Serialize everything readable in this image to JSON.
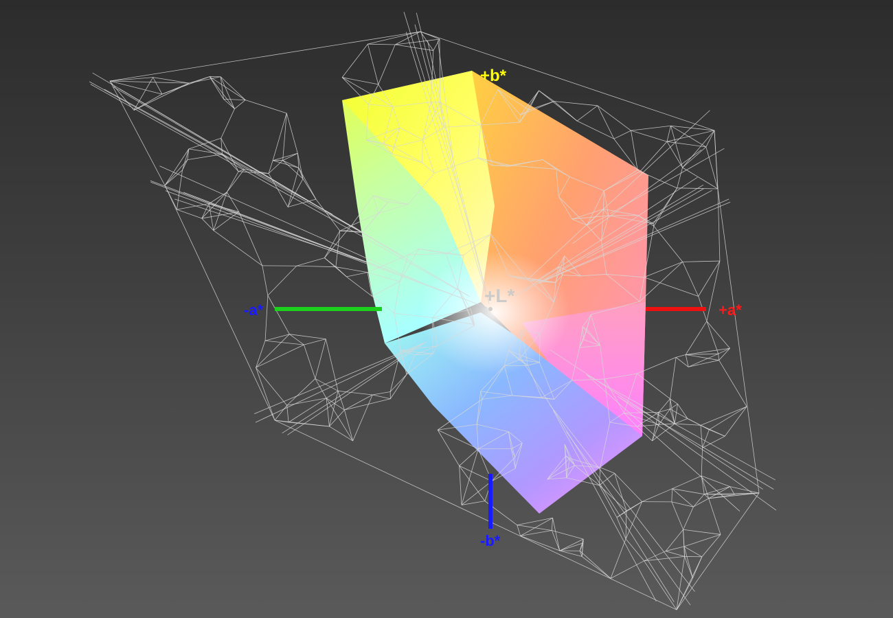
{
  "view": {
    "type": "CIE L*a*b* 3D gamut visualization",
    "background_gradient": [
      "#2c2c2c",
      "#5a5a5a"
    ],
    "wireframe_color": "#d8d8d8"
  },
  "axes": {
    "plus_b": {
      "label": "+b*",
      "color": "#ffff00"
    },
    "minus_b": {
      "label": "-b*",
      "color": "#1a1aff"
    },
    "plus_a": {
      "label": "+a*",
      "color": "#ff1a1a"
    },
    "minus_a": {
      "label": "-a*",
      "color": "#1a1aff"
    },
    "plus_L": {
      "label": "+L*",
      "color": "#c8c8c8"
    }
  },
  "gamut_colors": {
    "yellow": "#ffff22",
    "orange": "#ff9944",
    "red": "#ff7777",
    "magenta": "#ff88ff",
    "blue": "#7799ff",
    "cyan": "#88ffff",
    "green": "#ccff88",
    "white": "#fffff0"
  }
}
